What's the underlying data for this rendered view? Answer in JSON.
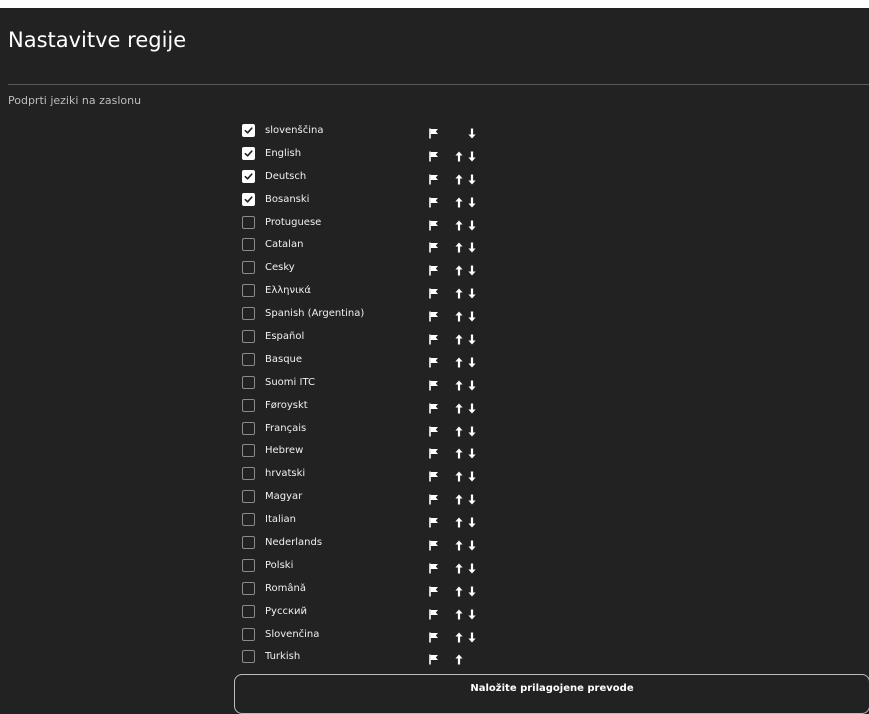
{
  "page": {
    "title": "Nastavitve regije",
    "section_label": "Podprti jeziki na zaslonu",
    "upload_button_label": "Naložite prilagojene prevode"
  },
  "languages": [
    {
      "name": "slovenščina",
      "checked": true,
      "up": false,
      "down": true
    },
    {
      "name": "English",
      "checked": true,
      "up": true,
      "down": true
    },
    {
      "name": "Deutsch",
      "checked": true,
      "up": true,
      "down": true
    },
    {
      "name": "Bosanski",
      "checked": true,
      "up": true,
      "down": true
    },
    {
      "name": "Protuguese",
      "checked": false,
      "up": true,
      "down": true
    },
    {
      "name": "Catalan",
      "checked": false,
      "up": true,
      "down": true
    },
    {
      "name": "Cesky",
      "checked": false,
      "up": true,
      "down": true
    },
    {
      "name": "Ελληνικά",
      "checked": false,
      "up": true,
      "down": true
    },
    {
      "name": "Spanish (Argentina)",
      "checked": false,
      "up": true,
      "down": true
    },
    {
      "name": "Español",
      "checked": false,
      "up": true,
      "down": true
    },
    {
      "name": "Basque",
      "checked": false,
      "up": true,
      "down": true
    },
    {
      "name": "Suomi ITC",
      "checked": false,
      "up": true,
      "down": true
    },
    {
      "name": "Føroyskt",
      "checked": false,
      "up": true,
      "down": true
    },
    {
      "name": "Français",
      "checked": false,
      "up": true,
      "down": true
    },
    {
      "name": "Hebrew",
      "checked": false,
      "up": true,
      "down": true
    },
    {
      "name": "hrvatski",
      "checked": false,
      "up": true,
      "down": true
    },
    {
      "name": "Magyar",
      "checked": false,
      "up": true,
      "down": true
    },
    {
      "name": "Italian",
      "checked": false,
      "up": true,
      "down": true
    },
    {
      "name": "Nederlands",
      "checked": false,
      "up": true,
      "down": true
    },
    {
      "name": "Polski",
      "checked": false,
      "up": true,
      "down": true
    },
    {
      "name": "Română",
      "checked": false,
      "up": true,
      "down": true
    },
    {
      "name": "Русский",
      "checked": false,
      "up": true,
      "down": true
    },
    {
      "name": "Slovenčina",
      "checked": false,
      "up": true,
      "down": true
    },
    {
      "name": "Turkish",
      "checked": false,
      "up": true,
      "down": false
    }
  ],
  "icons": {
    "row_icon": "flag-icon",
    "move_up": "arrow-up-icon",
    "move_down": "arrow-down-icon",
    "checkbox_mark": "check-icon"
  },
  "colors": {
    "background": "#222222",
    "text": "#ffffff",
    "checkbox_checked": "#ffffff",
    "divider": "#5a5a5a"
  }
}
